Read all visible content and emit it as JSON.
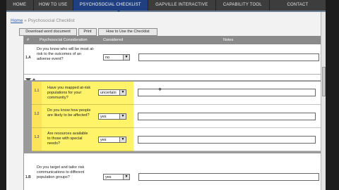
{
  "nav": {
    "items": [
      "HOME",
      "HOW TO USE",
      "PSYCHOSOCIAL CHECKLIST",
      "GAPVILLE INTERACTIVE",
      "CAPABILITY TOOL",
      "CONTACT"
    ],
    "active_color": "#1f3f80"
  },
  "breadcrumb": {
    "home": "Home",
    "sep": " » ",
    "current": "Psychosocial Checklist"
  },
  "toolbar": {
    "download": "Download word document",
    "print": "Print",
    "how_to": "How to Use the Checklist"
  },
  "table": {
    "headers": {
      "num": "#",
      "consideration": "Psychosocial Consideration",
      "considered": "Considered",
      "notes": "Notes"
    },
    "rows": [
      {
        "num": "1.A",
        "question": "Do you know who will be most at-risk to the outcomes of an adverse event?",
        "value": "no"
      },
      {
        "num": "1.B",
        "question": "Do you target and tailor risk communications to different population groups?",
        "value": "yes"
      }
    ],
    "sub_rows": [
      {
        "num": "1.1",
        "question": "Have you mapped at-risk populations for your community?",
        "value": "uncertain"
      },
      {
        "num": "1.2",
        "question": "Do you know how people are likely to be affected?",
        "value": "yes"
      },
      {
        "num": "1.3",
        "question": "Are resources available to those with special needs?",
        "value": "yes"
      }
    ]
  },
  "colors": {
    "sub_highlight": "#fff36a",
    "header_bg": "#8a8a8a",
    "nav_bg": "#3d3d3d"
  }
}
